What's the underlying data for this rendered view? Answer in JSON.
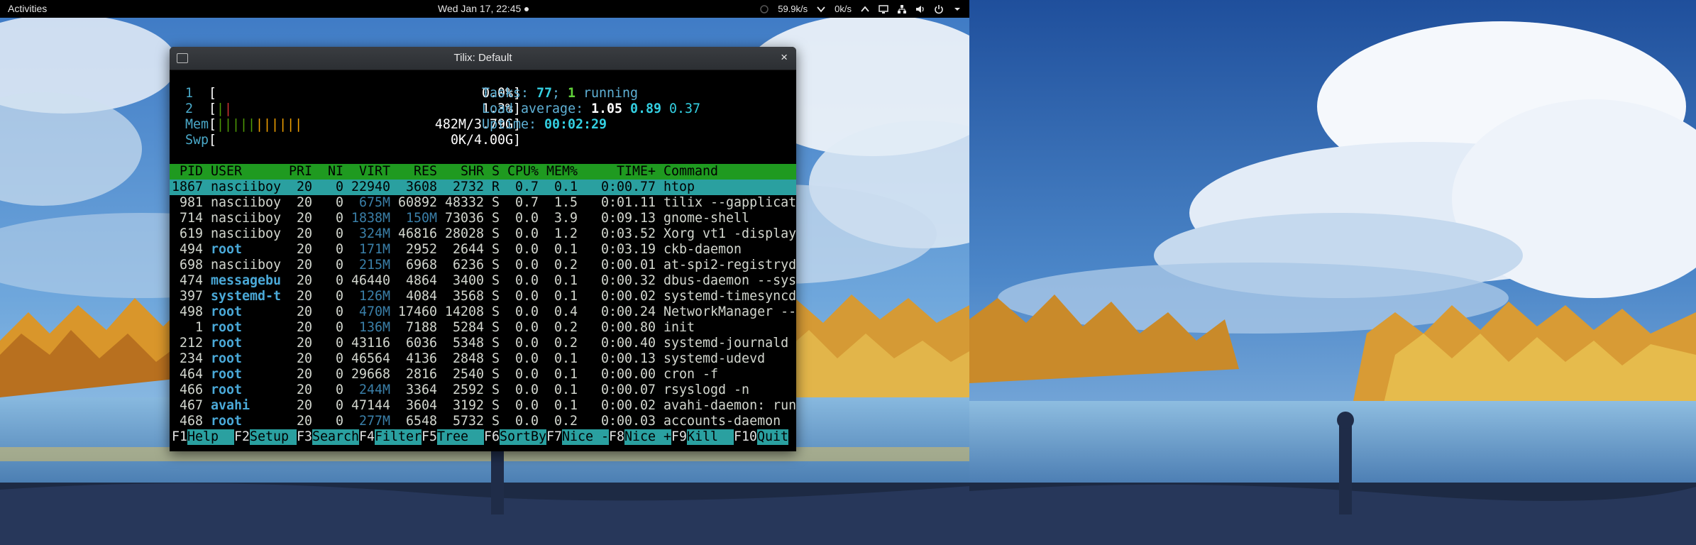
{
  "topbar": {
    "activities": "Activities",
    "clock": "Wed Jan 17, 22:45",
    "down_speed": "59.9k/s",
    "up_speed": "0k/s"
  },
  "window": {
    "title": "Tilix: Default",
    "close": "×"
  },
  "htop": {
    "cpu1": {
      "label": "1",
      "bar": "[",
      "value": "0.0%]"
    },
    "cpu2": {
      "label": "2",
      "bar": "[||",
      "value": "1.3%]"
    },
    "mem": {
      "label": "Mem",
      "value": "482M/3.79G]"
    },
    "swp": {
      "label": "Swp",
      "value": "0K/4.00G]"
    },
    "tasks_label": "Tasks:",
    "tasks_count": "77",
    "tasks_running": "1",
    "tasks_running_label": "running",
    "load_label": "Load average:",
    "load1": "1.05",
    "load5": "0.89",
    "load15": "0.37",
    "uptime_label": "Uptime:",
    "uptime": "00:02:29",
    "header": [
      "PID",
      "USER",
      "PRI",
      "NI",
      "VIRT",
      "RES",
      "SHR",
      "S",
      "CPU%",
      "MEM%",
      "TIME+",
      "Command"
    ],
    "rows": [
      {
        "pid": "1867",
        "user": "nasciiboy",
        "pri": "20",
        "ni": "0",
        "virt": "22940",
        "res": "3608",
        "shr": "2732",
        "s": "R",
        "cpu": "0.7",
        "mem": "0.1",
        "time": "0:00.77",
        "cmd": "htop"
      },
      {
        "pid": "981",
        "user": "nasciiboy",
        "pri": "20",
        "ni": "0",
        "virt": "675M",
        "res": "60892",
        "shr": "48332",
        "s": "S",
        "cpu": "0.7",
        "mem": "1.5",
        "time": "0:01.11",
        "cmd": "tilix --gapplicat"
      },
      {
        "pid": "714",
        "user": "nasciiboy",
        "pri": "20",
        "ni": "0",
        "virt": "1838M",
        "res": "150M",
        "shr": "73036",
        "s": "S",
        "cpu": "0.0",
        "mem": "3.9",
        "time": "0:09.13",
        "cmd": "gnome-shell"
      },
      {
        "pid": "619",
        "user": "nasciiboy",
        "pri": "20",
        "ni": "0",
        "virt": "324M",
        "res": "46816",
        "shr": "28028",
        "s": "S",
        "cpu": "0.0",
        "mem": "1.2",
        "time": "0:03.52",
        "cmd": "Xorg vt1 -display"
      },
      {
        "pid": "494",
        "user": "root",
        "pri": "20",
        "ni": "0",
        "virt": "171M",
        "res": "2952",
        "shr": "2644",
        "s": "S",
        "cpu": "0.0",
        "mem": "0.1",
        "time": "0:03.19",
        "cmd": "ckb-daemon"
      },
      {
        "pid": "698",
        "user": "nasciiboy",
        "pri": "20",
        "ni": "0",
        "virt": "215M",
        "res": "6968",
        "shr": "6236",
        "s": "S",
        "cpu": "0.0",
        "mem": "0.2",
        "time": "0:00.01",
        "cmd": "at-spi2-registryd"
      },
      {
        "pid": "474",
        "user": "messagebu",
        "pri": "20",
        "ni": "0",
        "virt": "46440",
        "res": "4864",
        "shr": "3400",
        "s": "S",
        "cpu": "0.0",
        "mem": "0.1",
        "time": "0:00.32",
        "cmd": "dbus-daemon --sys"
      },
      {
        "pid": "397",
        "user": "systemd-t",
        "pri": "20",
        "ni": "0",
        "virt": "126M",
        "res": "4084",
        "shr": "3568",
        "s": "S",
        "cpu": "0.0",
        "mem": "0.1",
        "time": "0:00.02",
        "cmd": "systemd-timesyncd"
      },
      {
        "pid": "498",
        "user": "root",
        "pri": "20",
        "ni": "0",
        "virt": "470M",
        "res": "17460",
        "shr": "14208",
        "s": "S",
        "cpu": "0.0",
        "mem": "0.4",
        "time": "0:00.24",
        "cmd": "NetworkManager --"
      },
      {
        "pid": "1",
        "user": "root",
        "pri": "20",
        "ni": "0",
        "virt": "136M",
        "res": "7188",
        "shr": "5284",
        "s": "S",
        "cpu": "0.0",
        "mem": "0.2",
        "time": "0:00.80",
        "cmd": "init"
      },
      {
        "pid": "212",
        "user": "root",
        "pri": "20",
        "ni": "0",
        "virt": "43116",
        "res": "6036",
        "shr": "5348",
        "s": "S",
        "cpu": "0.0",
        "mem": "0.2",
        "time": "0:00.40",
        "cmd": "systemd-journald"
      },
      {
        "pid": "234",
        "user": "root",
        "pri": "20",
        "ni": "0",
        "virt": "46564",
        "res": "4136",
        "shr": "2848",
        "s": "S",
        "cpu": "0.0",
        "mem": "0.1",
        "time": "0:00.13",
        "cmd": "systemd-udevd"
      },
      {
        "pid": "464",
        "user": "root",
        "pri": "20",
        "ni": "0",
        "virt": "29668",
        "res": "2816",
        "shr": "2540",
        "s": "S",
        "cpu": "0.0",
        "mem": "0.1",
        "time": "0:00.00",
        "cmd": "cron -f"
      },
      {
        "pid": "466",
        "user": "root",
        "pri": "20",
        "ni": "0",
        "virt": "244M",
        "res": "3364",
        "shr": "2592",
        "s": "S",
        "cpu": "0.0",
        "mem": "0.1",
        "time": "0:00.07",
        "cmd": "rsyslogd -n"
      },
      {
        "pid": "467",
        "user": "avahi",
        "pri": "20",
        "ni": "0",
        "virt": "47144",
        "res": "3604",
        "shr": "3192",
        "s": "S",
        "cpu": "0.0",
        "mem": "0.1",
        "time": "0:00.02",
        "cmd": "avahi-daemon: run"
      },
      {
        "pid": "468",
        "user": "root",
        "pri": "20",
        "ni": "0",
        "virt": "277M",
        "res": "6548",
        "shr": "5732",
        "s": "S",
        "cpu": "0.0",
        "mem": "0.2",
        "time": "0:00.03",
        "cmd": "accounts-daemon"
      }
    ],
    "fkeys": [
      {
        "key": "F1",
        "label": "Help  "
      },
      {
        "key": "F2",
        "label": "Setup "
      },
      {
        "key": "F3",
        "label": "Search"
      },
      {
        "key": "F4",
        "label": "Filter"
      },
      {
        "key": "F5",
        "label": "Tree  "
      },
      {
        "key": "F6",
        "label": "SortBy"
      },
      {
        "key": "F7",
        "label": "Nice -"
      },
      {
        "key": "F8",
        "label": "Nice +"
      },
      {
        "key": "F9",
        "label": "Kill  "
      },
      {
        "key": "F10",
        "label": "Quit"
      }
    ]
  }
}
